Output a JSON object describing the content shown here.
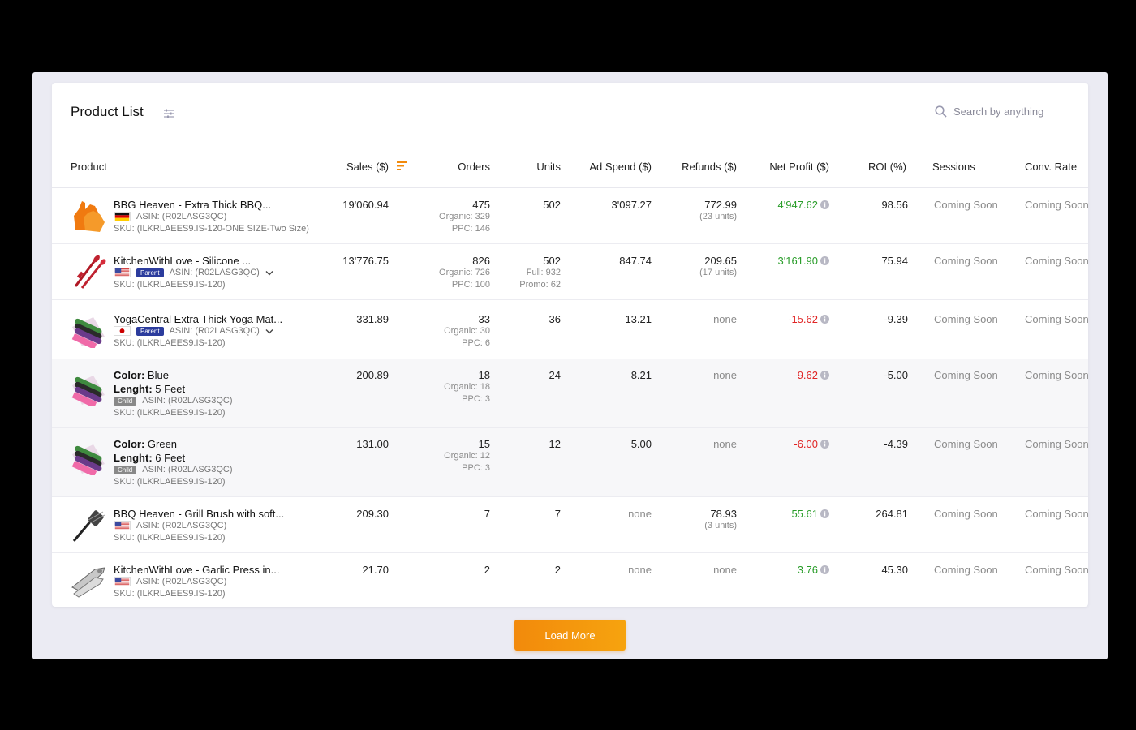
{
  "header": {
    "title": "Product List",
    "search_placeholder": "Search by anything"
  },
  "columns": {
    "product": "Product",
    "sales": "Sales ($)",
    "orders": "Orders",
    "units": "Units",
    "ad_spend": "Ad Spend ($)",
    "refunds": "Refunds ($)",
    "net_profit": "Net Profit ($)",
    "roi": "ROI (%)",
    "sessions": "Sessions",
    "conv_rate": "Conv. Rate"
  },
  "rows": [
    {
      "name": "BBG Heaven - Extra Thick BBQ...",
      "flag": "de",
      "asin": "ASIN: (R02LASG3QC)",
      "sku": "SKU: (ILKRLAEES9.IS-120-ONE SIZE-Two Size)",
      "sales": "19'060.94",
      "orders": "475",
      "orders_sub1": "Organic: 329",
      "orders_sub2": "PPC: 146",
      "units": "502",
      "ad_spend": "3'097.27",
      "refunds": "772.99",
      "refunds_sub": "(23 units)",
      "net_profit": "4'947.62",
      "roi": "98.56",
      "sessions": "Coming Soon",
      "conv_rate": "Coming Soon"
    },
    {
      "name": "KitchenWithLove - Silicone ...",
      "flag": "us",
      "badge": "Parent",
      "asin": "ASIN: (R02LASG3QC)",
      "sku": "SKU: (ILKRLAEES9.IS-120)",
      "sales": "13'776.75",
      "orders": "826",
      "orders_sub1": "Organic: 726",
      "orders_sub2": "PPC: 100",
      "units": "502",
      "units_sub1": "Full: 932",
      "units_sub2": "Promo: 62",
      "ad_spend": "847.74",
      "refunds": "209.65",
      "refunds_sub": "(17 units)",
      "net_profit": "3'161.90",
      "roi": "75.94",
      "sessions": "Coming Soon",
      "conv_rate": "Coming Soon"
    },
    {
      "name": "YogaCentral Extra Thick Yoga Mat...",
      "flag": "jp",
      "badge": "Parent",
      "asin": "ASIN: (R02LASG3QC)",
      "sku": "SKU: (ILKRLAEES9.IS-120)",
      "sales": "331.89",
      "orders": "33",
      "orders_sub1": "Organic: 30",
      "orders_sub2": "PPC: 6",
      "units": "36",
      "ad_spend": "13.21",
      "refunds": "none",
      "net_profit": "-15.62",
      "roi": "-9.39",
      "sessions": "Coming Soon",
      "conv_rate": "Coming Soon"
    },
    {
      "attr1_label": "Color:",
      "attr1_value": "Blue",
      "attr2_label": "Lenght:",
      "attr2_value": "5 Feet",
      "badge": "Child",
      "asin": "ASIN: (R02LASG3QC)",
      "sku": "SKU: (ILKRLAEES9.IS-120)",
      "sales": "200.89",
      "orders": "18",
      "orders_sub1": "Organic: 18",
      "orders_sub2": "PPC: 3",
      "units": "24",
      "ad_spend": "8.21",
      "refunds": "none",
      "net_profit": "-9.62",
      "roi": "-5.00",
      "sessions": "Coming Soon",
      "conv_rate": "Coming Soon"
    },
    {
      "attr1_label": "Color:",
      "attr1_value": "Green",
      "attr2_label": "Lenght:",
      "attr2_value": "6 Feet",
      "badge": "Child",
      "asin": "ASIN: (R02LASG3QC)",
      "sku": "SKU: (ILKRLAEES9.IS-120)",
      "sales": "131.00",
      "orders": "15",
      "orders_sub1": "Organic: 12",
      "orders_sub2": "PPC: 3",
      "units": "12",
      "ad_spend": "5.00",
      "refunds": "none",
      "net_profit": "-6.00",
      "roi": "-4.39",
      "sessions": "Coming Soon",
      "conv_rate": "Coming Soon"
    },
    {
      "name": "BBQ Heaven - Grill Brush with soft...",
      "flag": "us",
      "asin": "ASIN: (R02LASG3QC)",
      "sku": "SKU: (ILKRLAEES9.IS-120)",
      "sales": "209.30",
      "orders": "7",
      "units": "7",
      "ad_spend": "none",
      "refunds": "78.93",
      "refunds_sub": "(3 units)",
      "net_profit": "55.61",
      "roi": "264.81",
      "sessions": "Coming Soon",
      "conv_rate": "Coming Soon"
    },
    {
      "name": "KitchenWithLove - Garlic Press in...",
      "flag": "us",
      "asin": "ASIN: (R02LASG3QC)",
      "sku": "SKU: (ILKRLAEES9.IS-120)",
      "sales": "21.70",
      "orders": "2",
      "units": "2",
      "ad_spend": "none",
      "refunds": "none",
      "net_profit": "3.76",
      "roi": "45.30",
      "sessions": "Coming Soon",
      "conv_rate": "Coming Soon"
    }
  ],
  "footer": {
    "load_more_label": "Load More"
  },
  "colors": {
    "accent": "#f28a0c",
    "positive": "#2a9d2a",
    "negative": "#e02424",
    "parent_badge": "#2c3c9d"
  }
}
